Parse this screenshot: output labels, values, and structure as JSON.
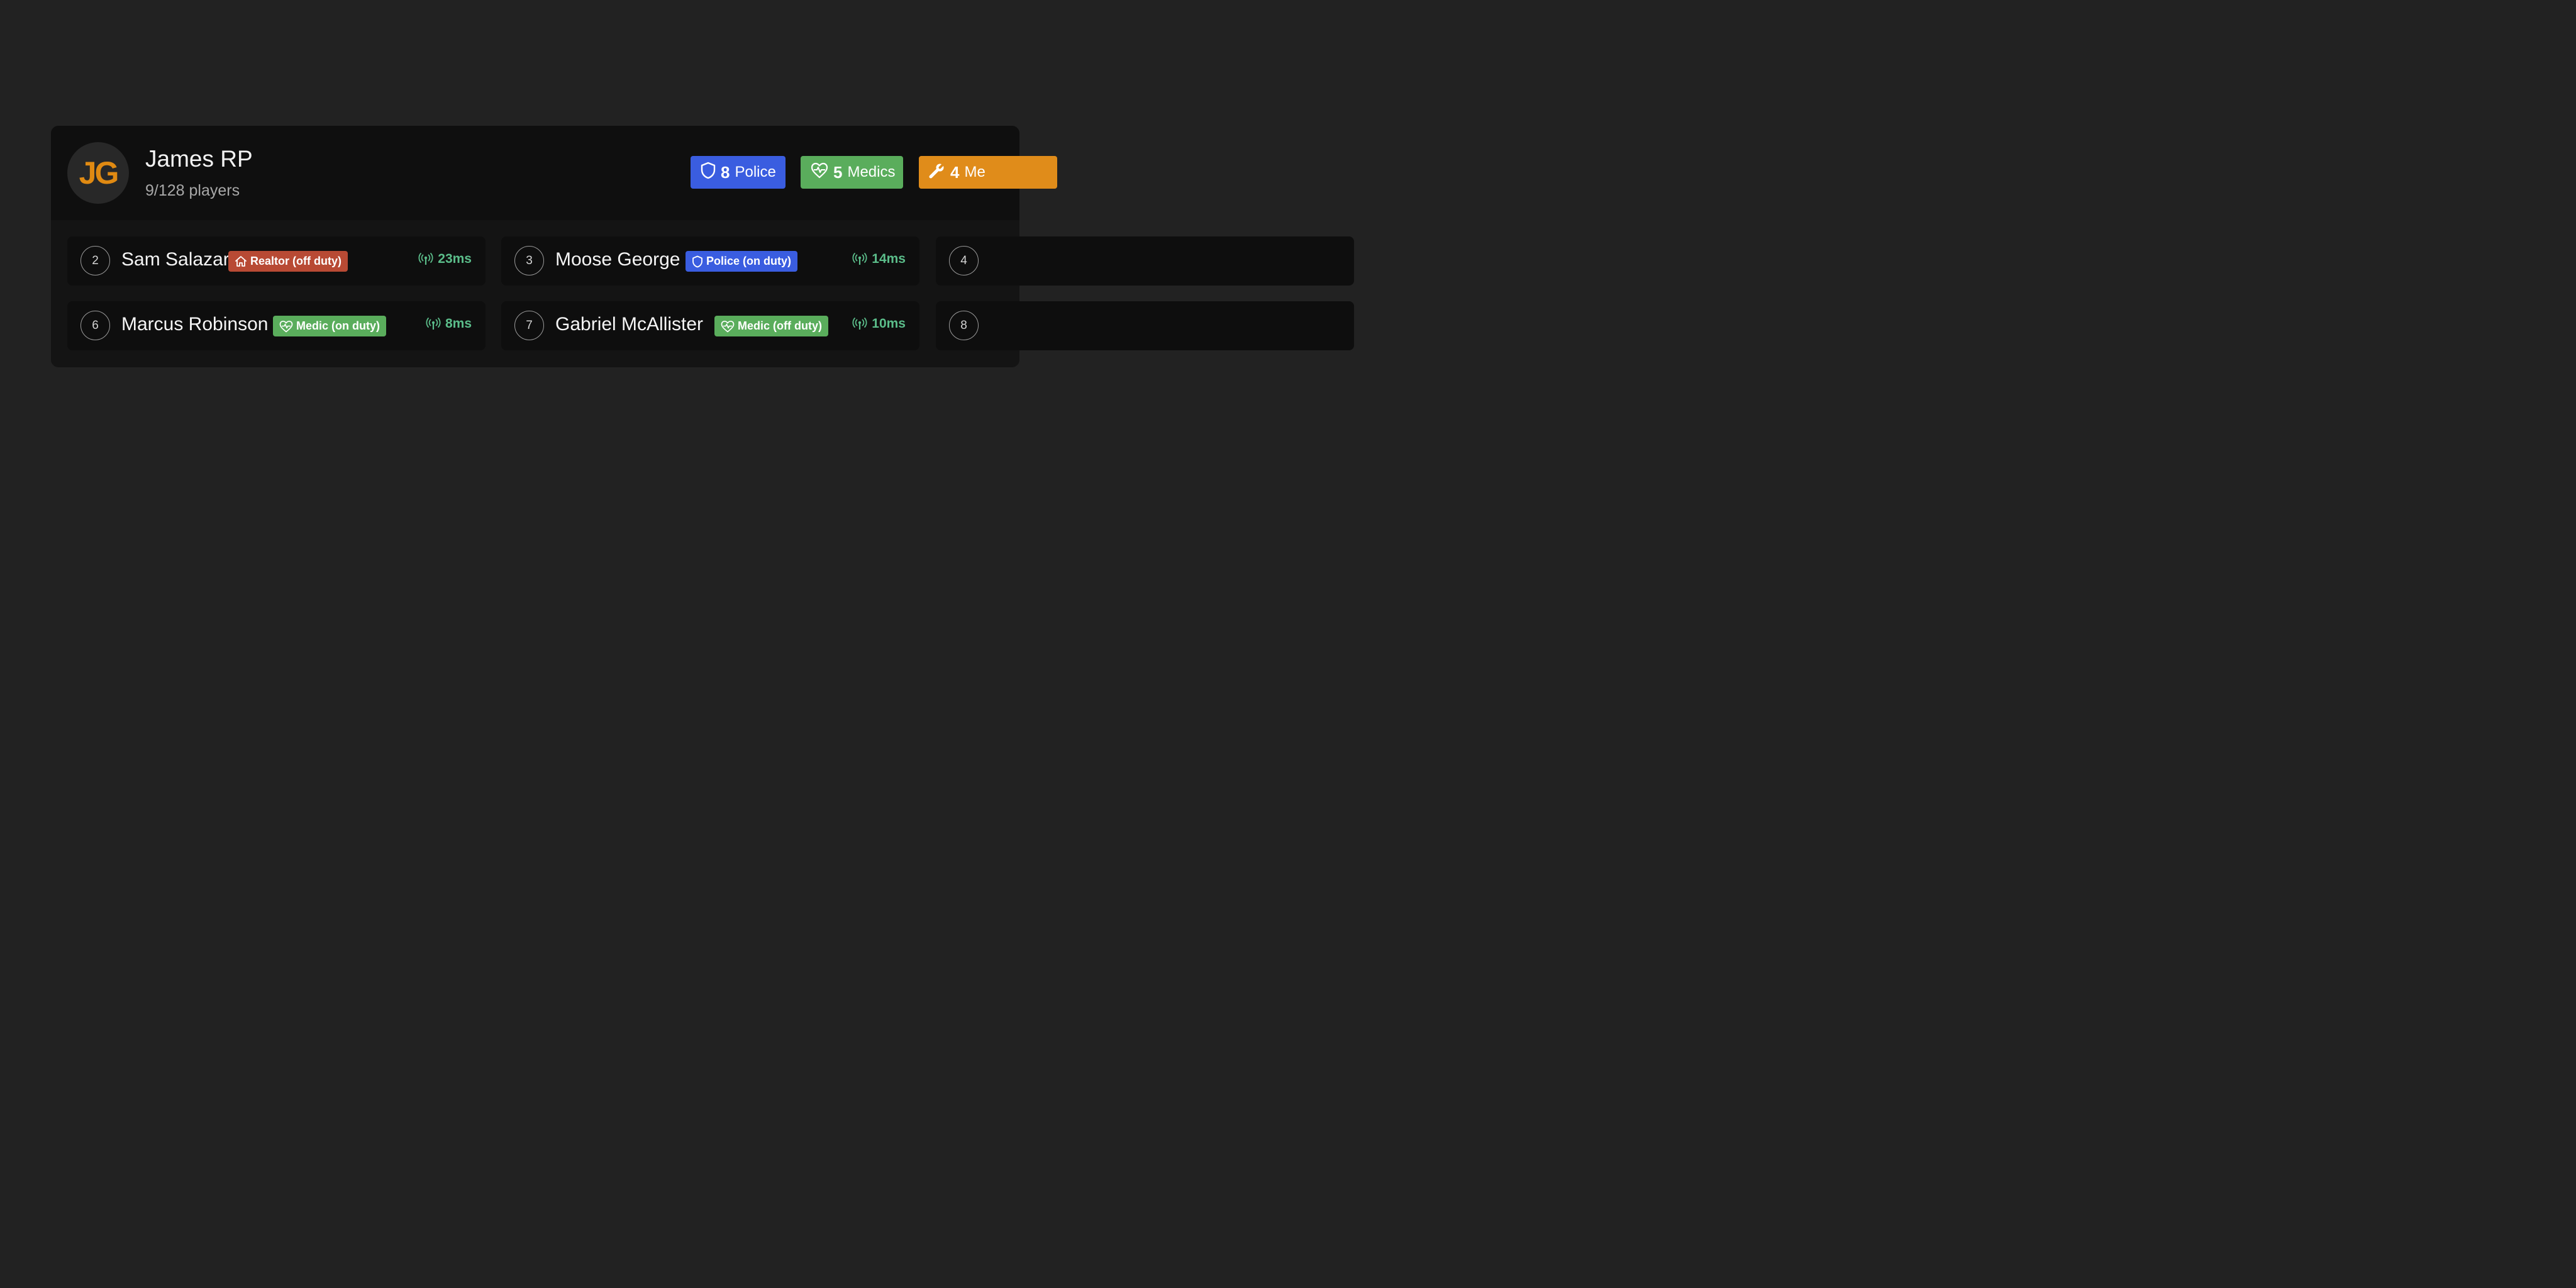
{
  "server": {
    "logo_text": "JG",
    "name": "James RP",
    "player_count": "9/128 players"
  },
  "stats": [
    {
      "count": "8",
      "label": "Police",
      "icon": "shield-icon",
      "color": "#3a5de0"
    },
    {
      "count": "5",
      "label": "Medics",
      "icon": "heart-pulse-icon",
      "color": "#5aad5c"
    },
    {
      "count": "4",
      "label": "Me",
      "icon": "wrench-icon",
      "color": "#e08c1a"
    }
  ],
  "players": [
    {
      "rank": "2",
      "name": "Sam Salazar",
      "job": "Realtor (off duty)",
      "job_icon": "house-icon",
      "job_color": "#b84a34",
      "ping": "23ms"
    },
    {
      "rank": "3",
      "name": "Moose George",
      "job": "Police (on duty)",
      "job_icon": "shield-icon",
      "job_color": "#3a5de0",
      "ping": "14ms"
    },
    {
      "rank": "4",
      "name": "",
      "job": "",
      "ping": ""
    },
    {
      "rank": "6",
      "name": "Marcus Robinson",
      "job": "Medic (on duty)",
      "job_icon": "heart-pulse-icon",
      "job_color": "#5aad5c",
      "ping": "8ms"
    },
    {
      "rank": "7",
      "name": "Gabriel McAllister",
      "job": "Medic (off duty)",
      "job_icon": "heart-pulse-icon",
      "job_color": "#5aad5c",
      "ping": "10ms"
    },
    {
      "rank": "8",
      "name": "",
      "job": "",
      "ping": ""
    }
  ],
  "colors": {
    "background": "#222222",
    "panel": "#141414",
    "card": "#0e0e0e",
    "ping": "#5bbd8a",
    "logo": "#e08a12"
  }
}
